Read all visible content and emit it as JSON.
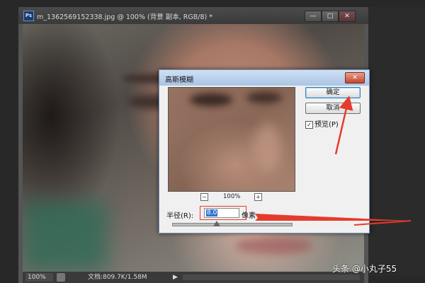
{
  "window": {
    "app_icon": "Ps",
    "title": "m_1362569152338.jpg @ 100% (背景 副本, RGB/8) *",
    "controls": {
      "minimize": "—",
      "maximize": "□",
      "close": "✕"
    }
  },
  "statusbar": {
    "zoom": "100%",
    "doc_info": "文档:809.7K/1.58M",
    "arrow": "▶"
  },
  "dialog": {
    "title": "高斯模糊",
    "close_glyph": "✕",
    "ok_label": "确定",
    "cancel_label": "取消",
    "preview_label": "预览(P)",
    "preview_checked": "✓",
    "zoom_out": "−",
    "zoom_in": "+",
    "zoom_level": "100%",
    "radius_label": "半径(R):",
    "radius_value": "8.0",
    "unit_label": "像素"
  },
  "watermark": "头条 @小丸子55",
  "colors": {
    "annotation_red": "#e53b2c",
    "selection_blue": "#3074d2",
    "dialog_title_blue": "#a9c4e4"
  }
}
